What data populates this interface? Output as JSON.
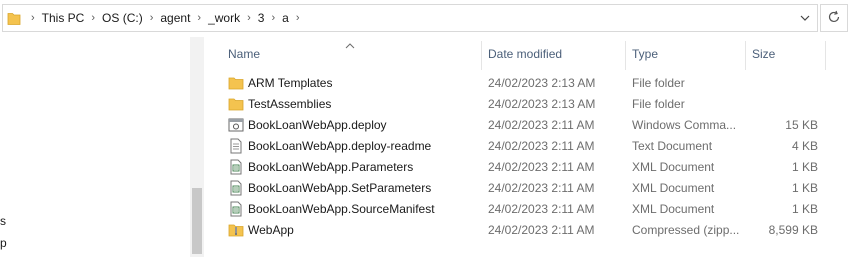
{
  "address_bar": {
    "breadcrumbs": [
      "This PC",
      "OS (C:)",
      "agent",
      "_work",
      "3",
      "a"
    ]
  },
  "left_pane": {
    "fragments": [
      "s",
      "p"
    ]
  },
  "columns": {
    "name": "Name",
    "date_modified": "Date modified",
    "type": "Type",
    "size": "Size",
    "sorted_by": "Name",
    "sort_direction": "ascending"
  },
  "files": [
    {
      "name": "ARM Templates",
      "date": "24/02/2023 2:13 AM",
      "type": "File folder",
      "size": "",
      "icon": "folder-icon"
    },
    {
      "name": "TestAssemblies",
      "date": "24/02/2023 2:13 AM",
      "type": "File folder",
      "size": "",
      "icon": "folder-icon"
    },
    {
      "name": "BookLoanWebApp.deploy",
      "date": "24/02/2023 2:11 AM",
      "type": "Windows Comma...",
      "size": "15 KB",
      "icon": "cmd-file-icon"
    },
    {
      "name": "BookLoanWebApp.deploy-readme",
      "date": "24/02/2023 2:11 AM",
      "type": "Text Document",
      "size": "4 KB",
      "icon": "text-document-icon"
    },
    {
      "name": "BookLoanWebApp.Parameters",
      "date": "24/02/2023 2:11 AM",
      "type": "XML Document",
      "size": "1 KB",
      "icon": "xml-document-icon"
    },
    {
      "name": "BookLoanWebApp.SetParameters",
      "date": "24/02/2023 2:11 AM",
      "type": "XML Document",
      "size": "1 KB",
      "icon": "xml-document-icon"
    },
    {
      "name": "BookLoanWebApp.SourceManifest",
      "date": "24/02/2023 2:11 AM",
      "type": "XML Document",
      "size": "1 KB",
      "icon": "xml-document-icon"
    },
    {
      "name": "WebApp",
      "date": "24/02/2023 2:11 AM",
      "type": "Compressed (zipp...",
      "size": "8,599 KB",
      "icon": "zip-folder-icon"
    }
  ],
  "colors": {
    "folder": "#f4c34f",
    "header_text": "#4c607a",
    "secondary_text": "#6d6d6d"
  }
}
